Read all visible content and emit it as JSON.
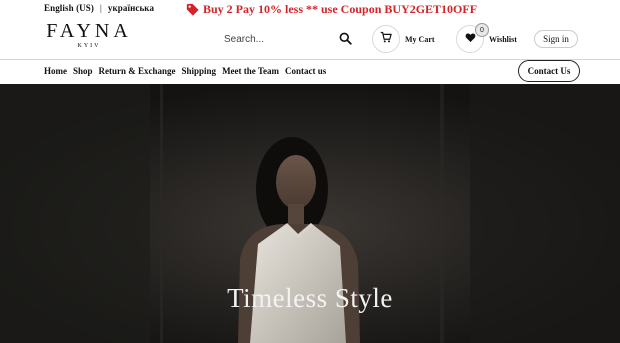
{
  "topbar": {
    "lang_en": "English (US)",
    "lang_uk": "українська",
    "lang_separator": "|",
    "promo_text": "Buy 2 Pay 10% less ** use Coupon BUY2GET10OFF",
    "promo_icon": "tag-icon",
    "promo_color": "#d3242a"
  },
  "logo": {
    "brand": "FAYNA",
    "city": "KYIV"
  },
  "search": {
    "placeholder": "Search...",
    "icon": "search-icon"
  },
  "cart": {
    "label": "My Cart",
    "icon": "cart-icon"
  },
  "wishlist": {
    "label": "Wishlist",
    "icon": "heart-icon",
    "count": "0"
  },
  "account": {
    "signin_label": "Sign in"
  },
  "nav": {
    "items": [
      "Home",
      "Shop",
      "Return & Exchange",
      "Shipping",
      "Meet the Team",
      "Contact us"
    ],
    "contact_button": "Contact Us"
  },
  "hero": {
    "title": "Timeless Style"
  }
}
